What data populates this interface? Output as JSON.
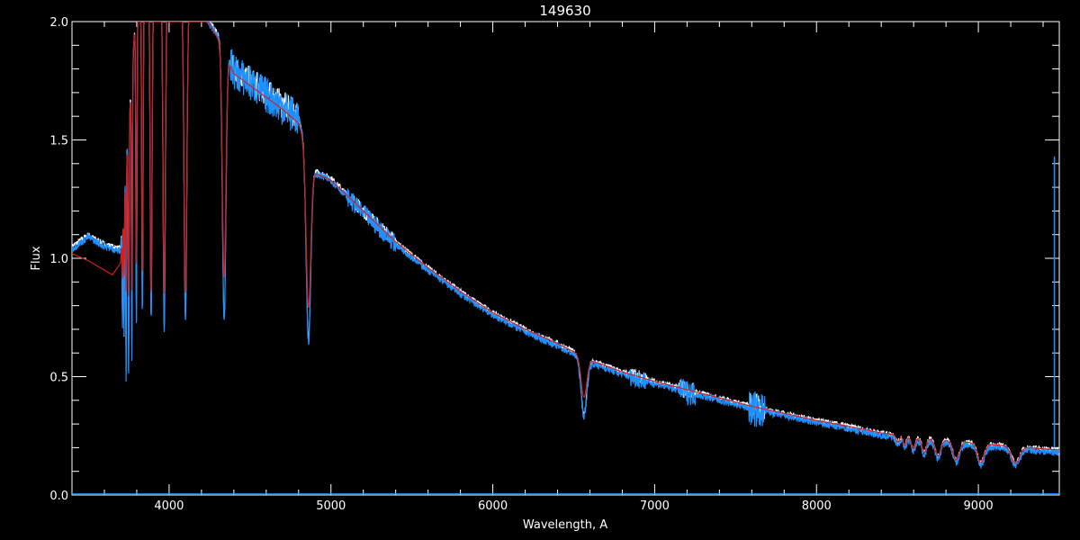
{
  "chart_data": {
    "type": "line",
    "title": "149630",
    "xlabel": "Wavelength, A",
    "ylabel": "Flux",
    "xlim": [
      3400,
      9500
    ],
    "ylim": [
      0.0,
      2.0
    ],
    "x_ticks": [
      4000,
      5000,
      6000,
      7000,
      8000,
      9000
    ],
    "x_tick_labels": [
      "4000",
      "5000",
      "6000",
      "7000",
      "8000",
      "9000"
    ],
    "x_minor_step": 200,
    "y_ticks": [
      0.0,
      0.5,
      1.0,
      1.5,
      2.0
    ],
    "y_tick_labels": [
      "0.0",
      "0.5",
      "1.0",
      "1.5",
      "2.0"
    ],
    "y_minor_step": 0.1,
    "grid": false,
    "background": "#000000",
    "axis_color": "#ffffff",
    "continuum": {
      "x": [
        3400,
        3500,
        3600,
        3700,
        3800,
        3900,
        4000,
        4100,
        4200,
        4300,
        4400,
        4500,
        4600,
        4700,
        4800,
        4900,
        5000,
        5200,
        5400,
        5600,
        5800,
        6000,
        6200,
        6400,
        6600,
        6800,
        7000,
        7200,
        7400,
        7600,
        7800,
        8000,
        8200,
        8400,
        8600,
        8800,
        9000,
        9200,
        9500
      ],
      "y": [
        1.05,
        1.1,
        1.06,
        1.04,
        2.1,
        2.15,
        2.15,
        2.1,
        2.05,
        1.95,
        1.8,
        1.75,
        1.7,
        1.65,
        1.6,
        1.37,
        1.34,
        1.2,
        1.07,
        0.96,
        0.86,
        0.77,
        0.7,
        0.64,
        0.57,
        0.52,
        0.48,
        0.445,
        0.41,
        0.375,
        0.345,
        0.315,
        0.29,
        0.262,
        0.245,
        0.232,
        0.218,
        0.206,
        0.19
      ]
    },
    "model_continuum": {
      "x": [
        3400,
        3500,
        3600,
        3650,
        3700,
        3800,
        3900,
        4000,
        4100,
        4200,
        4300,
        4400,
        4500,
        4600,
        4700,
        4800,
        4900,
        5000,
        5200,
        5400,
        5600,
        5800,
        6000,
        6200,
        6400,
        6600,
        6800,
        7000,
        7200,
        7400,
        7600,
        7800,
        8000,
        8200,
        8400,
        8600,
        8800,
        9000,
        9200,
        9500
      ],
      "y": [
        1.02,
        0.99,
        0.95,
        0.93,
        0.98,
        2.1,
        2.15,
        2.15,
        2.1,
        2.05,
        1.93,
        1.78,
        1.73,
        1.68,
        1.63,
        1.57,
        1.36,
        1.33,
        1.2,
        1.07,
        0.96,
        0.86,
        0.77,
        0.7,
        0.64,
        0.57,
        0.52,
        0.48,
        0.445,
        0.41,
        0.375,
        0.345,
        0.315,
        0.29,
        0.262,
        0.245,
        0.232,
        0.218,
        0.206,
        0.19
      ]
    },
    "absorption_lines": [
      {
        "x": 3712,
        "w": 3,
        "depth": 0.45,
        "model_depth": 0.2
      },
      {
        "x": 3722,
        "w": 3,
        "depth": 0.6,
        "model_depth": 0.3
      },
      {
        "x": 3734,
        "w": 3,
        "depth": 0.9,
        "model_depth": 0.5
      },
      {
        "x": 3750,
        "w": 4,
        "depth": 1.05,
        "model_depth": 0.7
      },
      {
        "x": 3770,
        "w": 4,
        "depth": 1.2,
        "model_depth": 0.9
      },
      {
        "x": 3798,
        "w": 5,
        "depth": 1.35,
        "model_depth": 1.1
      },
      {
        "x": 3835,
        "w": 6,
        "depth": 1.35,
        "model_depth": 1.2
      },
      {
        "x": 3889,
        "w": 8,
        "depth": 1.4,
        "model_depth": 1.3
      },
      {
        "x": 3970,
        "w": 10,
        "depth": 1.45,
        "model_depth": 1.3
      },
      {
        "x": 4101,
        "w": 12,
        "depth": 1.35,
        "model_depth": 1.25
      },
      {
        "x": 4340,
        "w": 15,
        "depth": 1.15,
        "model_depth": 0.95
      },
      {
        "x": 4861,
        "w": 20,
        "depth": 0.8,
        "model_depth": 0.65
      },
      {
        "x": 6563,
        "w": 25,
        "depth": 0.24,
        "model_depth": 0.17
      },
      {
        "x": 8502,
        "w": 15,
        "depth": 0.03,
        "model_depth": 0.03
      },
      {
        "x": 8545,
        "w": 15,
        "depth": 0.04,
        "model_depth": 0.04
      },
      {
        "x": 8598,
        "w": 18,
        "depth": 0.05,
        "model_depth": 0.05
      },
      {
        "x": 8665,
        "w": 20,
        "depth": 0.06,
        "model_depth": 0.06
      },
      {
        "x": 8750,
        "w": 25,
        "depth": 0.07,
        "model_depth": 0.07
      },
      {
        "x": 8863,
        "w": 28,
        "depth": 0.08,
        "model_depth": 0.08
      },
      {
        "x": 9015,
        "w": 30,
        "depth": 0.08,
        "model_depth": 0.08
      },
      {
        "x": 9229,
        "w": 35,
        "depth": 0.07,
        "model_depth": 0.07
      }
    ],
    "noise_regions": [
      {
        "x0": 4380,
        "x1": 4800,
        "amp": 0.06
      },
      {
        "x0": 5100,
        "x1": 5400,
        "amp": 0.03
      },
      {
        "x0": 6850,
        "x1": 6950,
        "amp": 0.03
      },
      {
        "x0": 7150,
        "x1": 7250,
        "amp": 0.04
      },
      {
        "x0": 7580,
        "x1": 7680,
        "amp": 0.06
      }
    ],
    "spike": {
      "x": 9470,
      "y": 1.43
    },
    "series": [
      {
        "name": "",
        "color": "#ffffff"
      },
      {
        "name": "",
        "color": "#1e90ff"
      },
      {
        "name": "",
        "color": "#d02020"
      }
    ]
  }
}
